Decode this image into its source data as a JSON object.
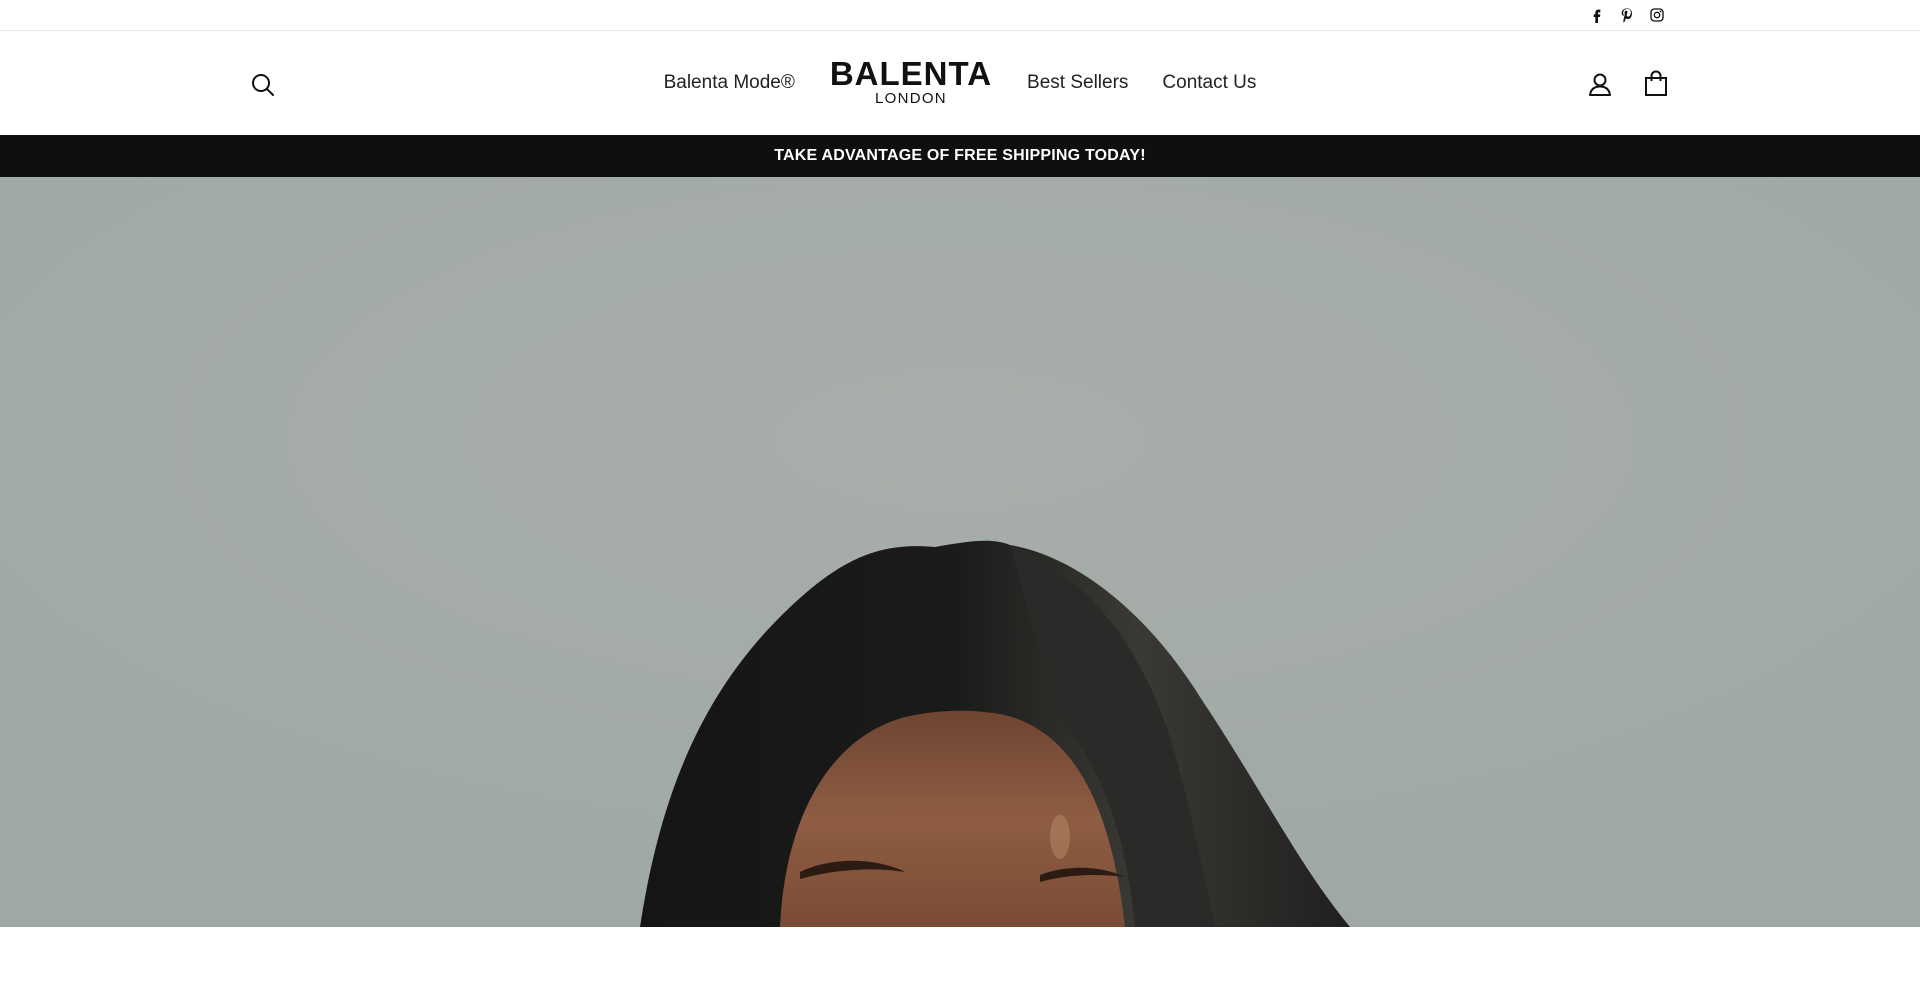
{
  "social": {
    "facebook": "facebook-icon",
    "pinterest": "pinterest-icon",
    "instagram": "instagram-icon"
  },
  "header": {
    "search_icon": "search-icon",
    "nav_left": "Balenta Mode®",
    "logo_main": "BALENTA",
    "logo_sub": "LONDON",
    "nav_right_1": "Best Sellers",
    "nav_right_2": "Contact Us",
    "account_icon": "user-icon",
    "cart_icon": "shopping-bag-icon"
  },
  "announcement": {
    "text": "TAKE ADVANTAGE OF FREE SHIPPING TODAY!"
  },
  "hero": {
    "image": "woman-dark-hair-portrait"
  },
  "colors": {
    "announcement_bg": "#0f0f0f",
    "hero_bg": "#a6ada9",
    "hair": "#141414",
    "skin": "#8a5a3e"
  }
}
